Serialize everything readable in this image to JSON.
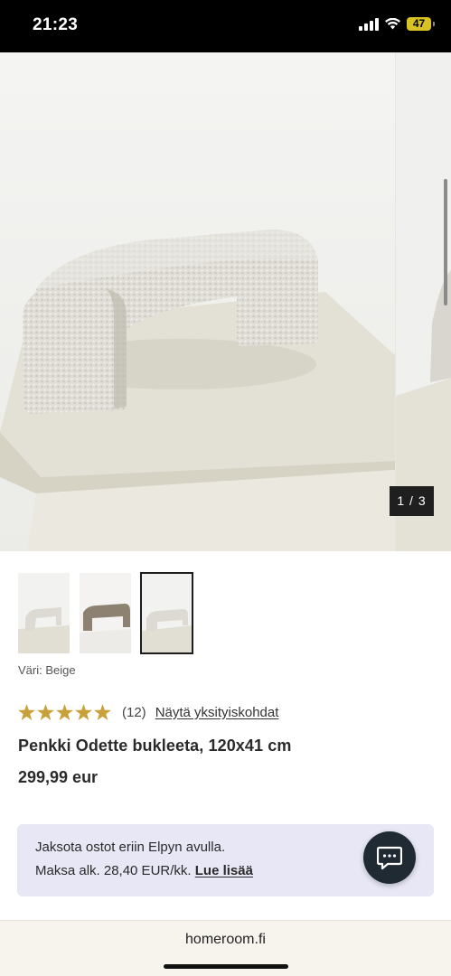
{
  "status_bar": {
    "time": "21:23",
    "battery": "47",
    "icons": [
      "signal-icon",
      "wifi-icon",
      "battery-icon"
    ]
  },
  "gallery": {
    "counter": "1 / 3",
    "current_image": 1,
    "total_images": 3
  },
  "thumbnails": [
    {
      "name": "thumb-beige-side",
      "selected": false
    },
    {
      "name": "thumb-taupe",
      "selected": false
    },
    {
      "name": "thumb-beige-front",
      "selected": true
    }
  ],
  "product": {
    "color_label": "Väri: Beige",
    "rating": 5,
    "review_count": "(12)",
    "review_link": "Näytä yksityiskohdat",
    "title": "Penkki Odette bukleeta, 120x41 cm",
    "price": "299,99 eur"
  },
  "payment": {
    "line1": "Jaksota ostot eriin Elpyn avulla.",
    "line2": "Maksa alk. 28,40 EUR/kk.",
    "link": "Lue lisää"
  },
  "chat": {
    "icon": "chat-icon"
  },
  "browser": {
    "url": "homeroom.fi"
  },
  "colors": {
    "star": "#c9a13b",
    "payment_bg": "#e8e7f6",
    "chat_bg": "#1f2a33",
    "counter_bg": "#1f1f1f"
  }
}
